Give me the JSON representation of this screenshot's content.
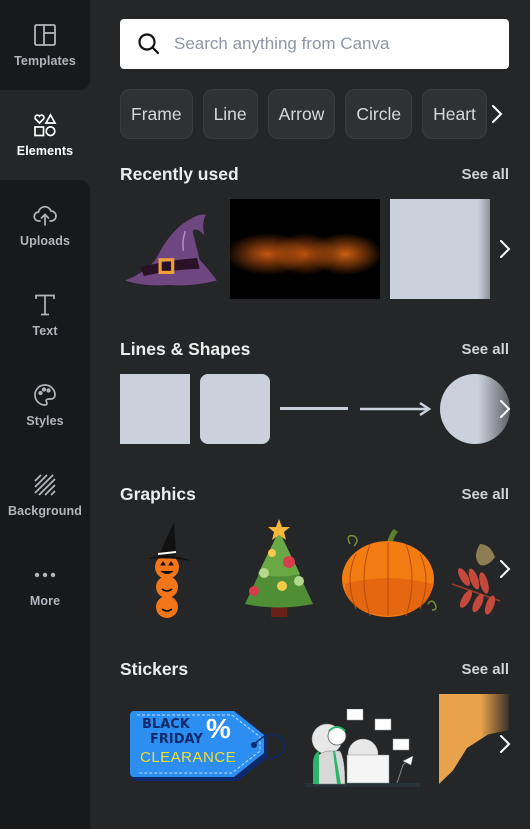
{
  "sidebar": {
    "items": [
      {
        "label": "Templates",
        "icon": "templates-icon",
        "active": false
      },
      {
        "label": "Elements",
        "icon": "elements-icon",
        "active": true
      },
      {
        "label": "Uploads",
        "icon": "upload-cloud-icon",
        "active": false
      },
      {
        "label": "Text",
        "icon": "text-icon",
        "active": false
      },
      {
        "label": "Styles",
        "icon": "palette-icon",
        "active": false
      },
      {
        "label": "Background",
        "icon": "background-stripes-icon",
        "active": false
      },
      {
        "label": "More",
        "icon": "more-dots-icon",
        "active": false
      }
    ]
  },
  "search": {
    "placeholder": "Search anything from Canva",
    "value": ""
  },
  "chips": [
    "Frame",
    "Line",
    "Arrow",
    "Circle",
    "Heart"
  ],
  "sections": {
    "recently_used": {
      "title": "Recently used",
      "see_all": "See all",
      "items": [
        "witch-hat-graphic",
        "halloween-night-photo",
        "square-shape"
      ]
    },
    "lines_shapes": {
      "title": "Lines & Shapes",
      "see_all": "See all",
      "items": [
        "square",
        "rounded-square",
        "line",
        "arrow-line",
        "circle"
      ]
    },
    "graphics": {
      "title": "Graphics",
      "see_all": "See all",
      "items": [
        "stacked-pumpkins-witch-hat",
        "christmas-tree",
        "pumpkin",
        "autumn-leaves"
      ]
    },
    "stickers": {
      "title": "Stickers",
      "see_all": "See all",
      "items": [
        {
          "name": "black-friday-tag",
          "text": [
            "BLACK",
            "FRIDAY",
            "CLEARANCE"
          ],
          "symbol": "%"
        },
        {
          "name": "customer-support-illustration"
        },
        {
          "name": "orange-blob"
        }
      ]
    }
  },
  "colors": {
    "panel_bg": "#252627",
    "sidebar_bg": "#18191b",
    "shape_fill": "#cbd1da",
    "chip_bg": "#303133"
  }
}
